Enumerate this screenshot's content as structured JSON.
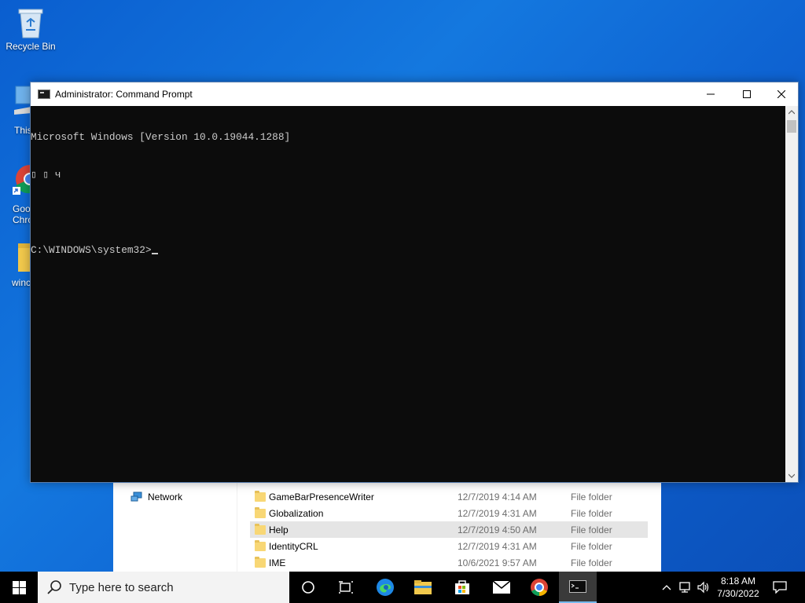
{
  "desktop": {
    "icons": [
      {
        "label": "Recycle Bin"
      },
      {
        "label": "This"
      },
      {
        "label": "Goo"
      },
      {
        "label": "Chro"
      },
      {
        "label": "winc"
      }
    ]
  },
  "explorer": {
    "nav_network": "Network",
    "rows": [
      {
        "name": "GameBarPresenceWriter",
        "date": "12/7/2019 4:14 AM",
        "type": "File folder"
      },
      {
        "name": "Globalization",
        "date": "12/7/2019 4:31 AM",
        "type": "File folder"
      },
      {
        "name": "Help",
        "date": "12/7/2019 4:50 AM",
        "type": "File folder"
      },
      {
        "name": "IdentityCRL",
        "date": "12/7/2019 4:31 AM",
        "type": "File folder"
      },
      {
        "name": "IME",
        "date": "10/6/2021 9:57 AM",
        "type": "File folder"
      }
    ]
  },
  "cmd": {
    "title": "Administrator: Command Prompt",
    "lines": [
      "Microsoft Windows [Version 10.0.19044.1288]",
      "▯ ▯ ч",
      "",
      "C:\\WINDOWS\\system32>"
    ]
  },
  "taskbar": {
    "search_placeholder": "Type here to search",
    "time": "8:18 AM",
    "date": "7/30/2022"
  },
  "colors": {
    "desktop": "#1478df",
    "console_bg": "#0c0c0c",
    "console_fg": "#cccccc",
    "taskbar": "#000000",
    "active_indicator": "#76b9ed"
  }
}
